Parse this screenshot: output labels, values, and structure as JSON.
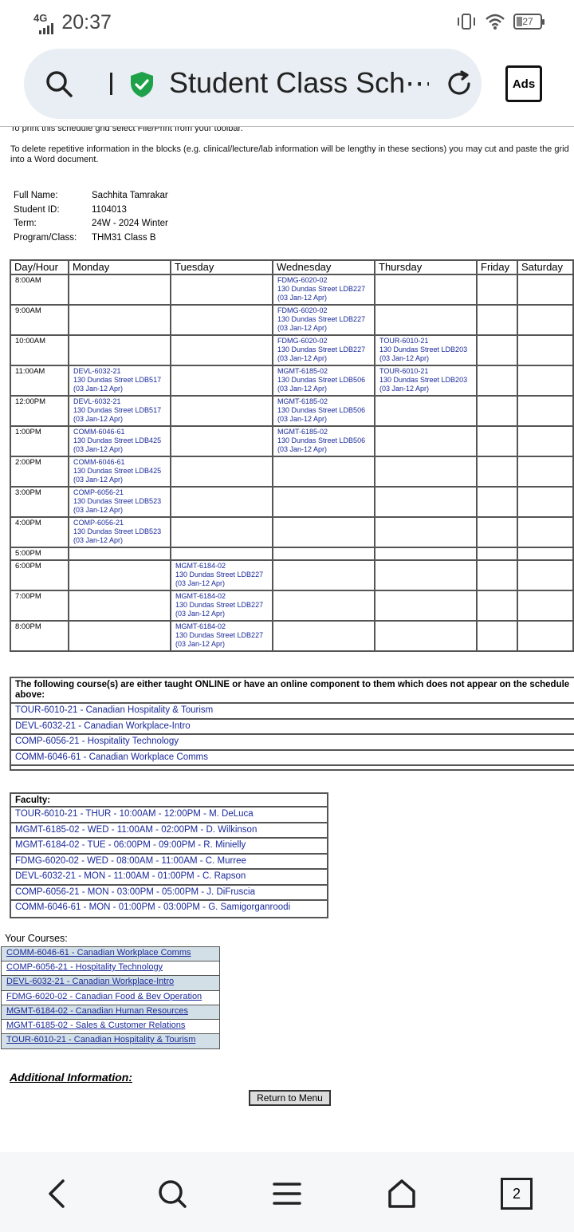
{
  "status_bar": {
    "network": "4G",
    "time": "20:37",
    "battery": "27"
  },
  "browser": {
    "url_text": "Student Class Sch⋯",
    "ads_label": "Ads"
  },
  "intro": {
    "print_note": "To print this schedule grid select File/Print from your toolbar.",
    "delete_note": "To delete repetitive information in the blocks (e.g. clinical/lecture/lab information will be lengthy in these sections) you may cut and paste the grid into a Word document."
  },
  "student": [
    {
      "label": "Full Name:",
      "value": "Sachhita Tamrakar"
    },
    {
      "label": "Student ID:",
      "value": "1104013"
    },
    {
      "label": "Term:",
      "value": "24W - 2024 Winter"
    },
    {
      "label": "Program/Class:",
      "value": "THM31 Class B"
    }
  ],
  "schedule": {
    "headers": [
      "Day/Hour",
      "Monday",
      "Tuesday",
      "Wednesday",
      "Thursday",
      "Friday",
      "Saturday"
    ],
    "rows": [
      {
        "hour": "8:00AM",
        "cells": [
          "",
          "",
          "FDMG-6020-02\n130 Dundas Street LDB227\n(03 Jan-12 Apr)",
          "",
          "",
          ""
        ]
      },
      {
        "hour": "9:00AM",
        "cells": [
          "",
          "",
          "FDMG-6020-02\n130 Dundas Street LDB227\n(03 Jan-12 Apr)",
          "",
          "",
          ""
        ]
      },
      {
        "hour": "10:00AM",
        "cells": [
          "",
          "",
          "FDMG-6020-02\n130 Dundas Street LDB227\n(03 Jan-12 Apr)",
          "TOUR-6010-21\n130 Dundas Street LDB203\n(03 Jan-12 Apr)",
          "",
          ""
        ]
      },
      {
        "hour": "11:00AM",
        "cells": [
          "DEVL-6032-21\n130 Dundas Street LDB517\n(03 Jan-12 Apr)",
          "",
          "MGMT-6185-02\n130 Dundas Street LDB506\n(03 Jan-12 Apr)",
          "TOUR-6010-21\n130 Dundas Street LDB203\n(03 Jan-12 Apr)",
          "",
          ""
        ]
      },
      {
        "hour": "12:00PM",
        "cells": [
          "DEVL-6032-21\n130 Dundas Street LDB517\n(03 Jan-12 Apr)",
          "",
          "MGMT-6185-02\n130 Dundas Street LDB506\n(03 Jan-12 Apr)",
          "",
          "",
          ""
        ]
      },
      {
        "hour": "1:00PM",
        "cells": [
          "COMM-6046-61\n130 Dundas Street LDB425\n(03 Jan-12 Apr)",
          "",
          "MGMT-6185-02\n130 Dundas Street LDB506\n(03 Jan-12 Apr)",
          "",
          "",
          ""
        ]
      },
      {
        "hour": "2:00PM",
        "cells": [
          "COMM-6046-61\n130 Dundas Street LDB425\n(03 Jan-12 Apr)",
          "",
          "",
          "",
          "",
          ""
        ]
      },
      {
        "hour": "3:00PM",
        "cells": [
          "COMP-6056-21\n130 Dundas Street LDB523\n(03 Jan-12 Apr)",
          "",
          "",
          "",
          "",
          ""
        ]
      },
      {
        "hour": "4:00PM",
        "cells": [
          "COMP-6056-21\n130 Dundas Street LDB523\n(03 Jan-12 Apr)",
          "",
          "",
          "",
          "",
          ""
        ]
      },
      {
        "hour": "5:00PM",
        "cells": [
          "",
          "",
          "",
          "",
          "",
          ""
        ]
      },
      {
        "hour": "6:00PM",
        "cells": [
          "",
          "MGMT-6184-02\n130 Dundas Street LDB227\n(03 Jan-12 Apr)",
          "",
          "",
          "",
          ""
        ]
      },
      {
        "hour": "7:00PM",
        "cells": [
          "",
          "MGMT-6184-02\n130 Dundas Street LDB227\n(03 Jan-12 Apr)",
          "",
          "",
          "",
          ""
        ]
      },
      {
        "hour": "8:00PM",
        "cells": [
          "",
          "MGMT-6184-02\n130 Dundas Street LDB227\n(03 Jan-12 Apr)",
          "",
          "",
          "",
          ""
        ]
      }
    ]
  },
  "online": {
    "heading": "The following course(s) are either taught ONLINE or have an online component to them which does not appear on the schedule above:",
    "courses": [
      "TOUR-6010-21 - Canadian Hospitality & Tourism",
      "DEVL-6032-21 - Canadian Workplace-Intro",
      "COMP-6056-21 - Hospitality Technology",
      "COMM-6046-61 - Canadian Workplace Comms"
    ]
  },
  "faculty": {
    "heading": "Faculty:",
    "rows": [
      "TOUR-6010-21 - THUR - 10:00AM - 12:00PM - M. DeLuca",
      "MGMT-6185-02 - WED - 11:00AM - 02:00PM - D. Wilkinson",
      "MGMT-6184-02 - TUE - 06:00PM - 09:00PM - R. Minielly",
      "FDMG-6020-02 - WED - 08:00AM - 11:00AM - C. Murree",
      "DEVL-6032-21 - MON - 11:00AM - 01:00PM - C. Rapson",
      "COMP-6056-21 - MON - 03:00PM - 05:00PM - J. DiFruscia",
      "COMM-6046-61 - MON - 01:00PM - 03:00PM - G. Samigorganroodi"
    ]
  },
  "your_courses": {
    "heading": "Your Courses:",
    "items": [
      "COMM-6046-61 - Canadian Workplace Comms",
      "COMP-6056-21 - Hospitality Technology",
      "DEVL-6032-21 - Canadian Workplace-Intro",
      "FDMG-6020-02 - Canadian Food & Bev Operation",
      "MGMT-6184-02 - Canadian Human Resources",
      "MGMT-6185-02 - Sales & Customer Relations",
      "TOUR-6010-21 - Canadian Hospitality & Tourism"
    ]
  },
  "additional_info_label": "Additional Information:",
  "return_button": "Return to Menu",
  "nav": {
    "tabs_count": "2"
  },
  "colors": {
    "link": "#1a2a9a",
    "shield": "#1fa14a",
    "row_shade": "#d3dfe6"
  },
  "icons": [
    "search-icon",
    "shield-icon",
    "reload-icon",
    "back-icon",
    "menu-icon",
    "home-icon",
    "tabs-icon"
  ]
}
